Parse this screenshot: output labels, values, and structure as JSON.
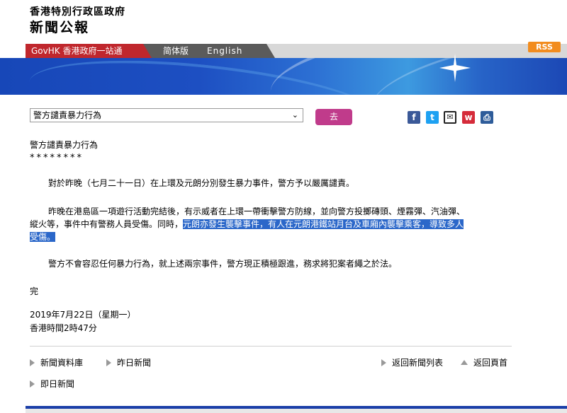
{
  "header": {
    "gov_name": "香港特別行政區政府",
    "press_title": "新聞公報"
  },
  "nav": {
    "govhk": "GovHK 香港政府一站通",
    "simplified": "简体版",
    "english": "English",
    "rss": "RSS"
  },
  "toolbar": {
    "select_value": "警方譴責暴力行為",
    "go_label": "去",
    "share_icons": [
      "facebook-icon",
      "twitter-icon",
      "mail-icon",
      "weibo-icon",
      "print-icon"
    ]
  },
  "article": {
    "title": "警方譴責暴力行為",
    "stars": "********",
    "p1": "對於昨晚（七月二十一日）在上環及元朗分別發生暴力事件，警方予以嚴厲譴責。",
    "p2_line1": "昨晚在港島區一項遊行活動完結後，有示威者在上環一帶衝擊警方防線，並向警方投擲磚頭、煙霧彈、汽油彈、",
    "p2_line2_plain": "縱火等，事件中有警務人員受傷。同時，",
    "p2_line2_highlight": "元朗亦發生襲擊事件，有人在元朗港鐵站月台及車廂內襲擊乘客，導致多人",
    "p2_line3_highlight": "受傷。",
    "p3": "警方不會容忍任何暴力行為，就上述兩宗事件，警方現正積極跟進，務求將犯案者繩之於法。",
    "end": "完",
    "date": "2019年7月22日（星期一）",
    "time": "香港時間2時47分"
  },
  "footer_links": {
    "news_archive": "新聞資料庫",
    "yesterday": "昨日新聞",
    "back_list": "返回新聞列表",
    "back_top": "返回頁首",
    "today": "即日新聞"
  },
  "colors": {
    "govhk_red": "#c0272d",
    "go_button": "#c03b8b",
    "highlight": "#2b67c9",
    "rss_orange": "#f28c1e"
  }
}
